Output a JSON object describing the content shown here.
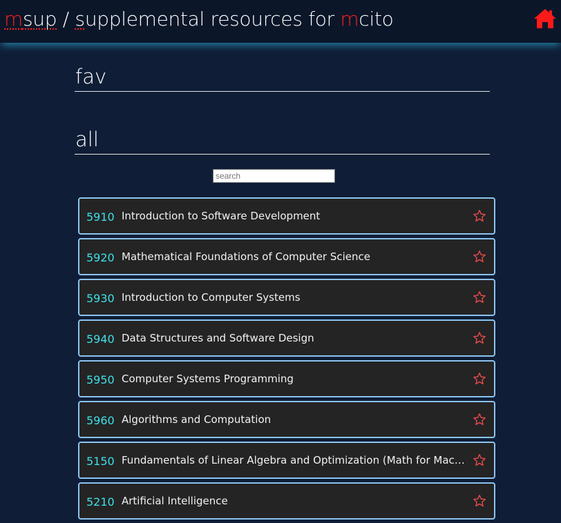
{
  "header": {
    "brand_m": "m",
    "brand_sup": "sup",
    "brand_sep": " / ",
    "brand_s": "s",
    "brand_rest": "upplemental resources for ",
    "brand_m2": "m",
    "brand_cito": "cito",
    "home_icon": "home-icon",
    "accent_color": "#ff1f1f"
  },
  "sections": {
    "fav": "fav",
    "all": "all"
  },
  "search": {
    "placeholder": "search",
    "value": ""
  },
  "courses": [
    {
      "number": "5910",
      "title": "Introduction to Software Development",
      "favorite": false
    },
    {
      "number": "5920",
      "title": "Mathematical Foundations of Computer Science",
      "favorite": false
    },
    {
      "number": "5930",
      "title": "Introduction to Computer Systems",
      "favorite": false
    },
    {
      "number": "5940",
      "title": "Data Structures and Software Design",
      "favorite": false
    },
    {
      "number": "5950",
      "title": "Computer Systems Programming",
      "favorite": false
    },
    {
      "number": "5960",
      "title": "Algorithms and Computation",
      "favorite": false
    },
    {
      "number": "5150",
      "title": "Fundamentals of Linear Algebra and Optimization (Math for Machine Learning)",
      "favorite": false
    },
    {
      "number": "5210",
      "title": "Artificial Intelligence",
      "favorite": false
    }
  ],
  "colors": {
    "background": "#0f1e36",
    "header": "#0b1629",
    "card": "#242424",
    "card_border": "#8cc3f0",
    "course_number": "#3fe0e8",
    "star": "#e04848"
  }
}
